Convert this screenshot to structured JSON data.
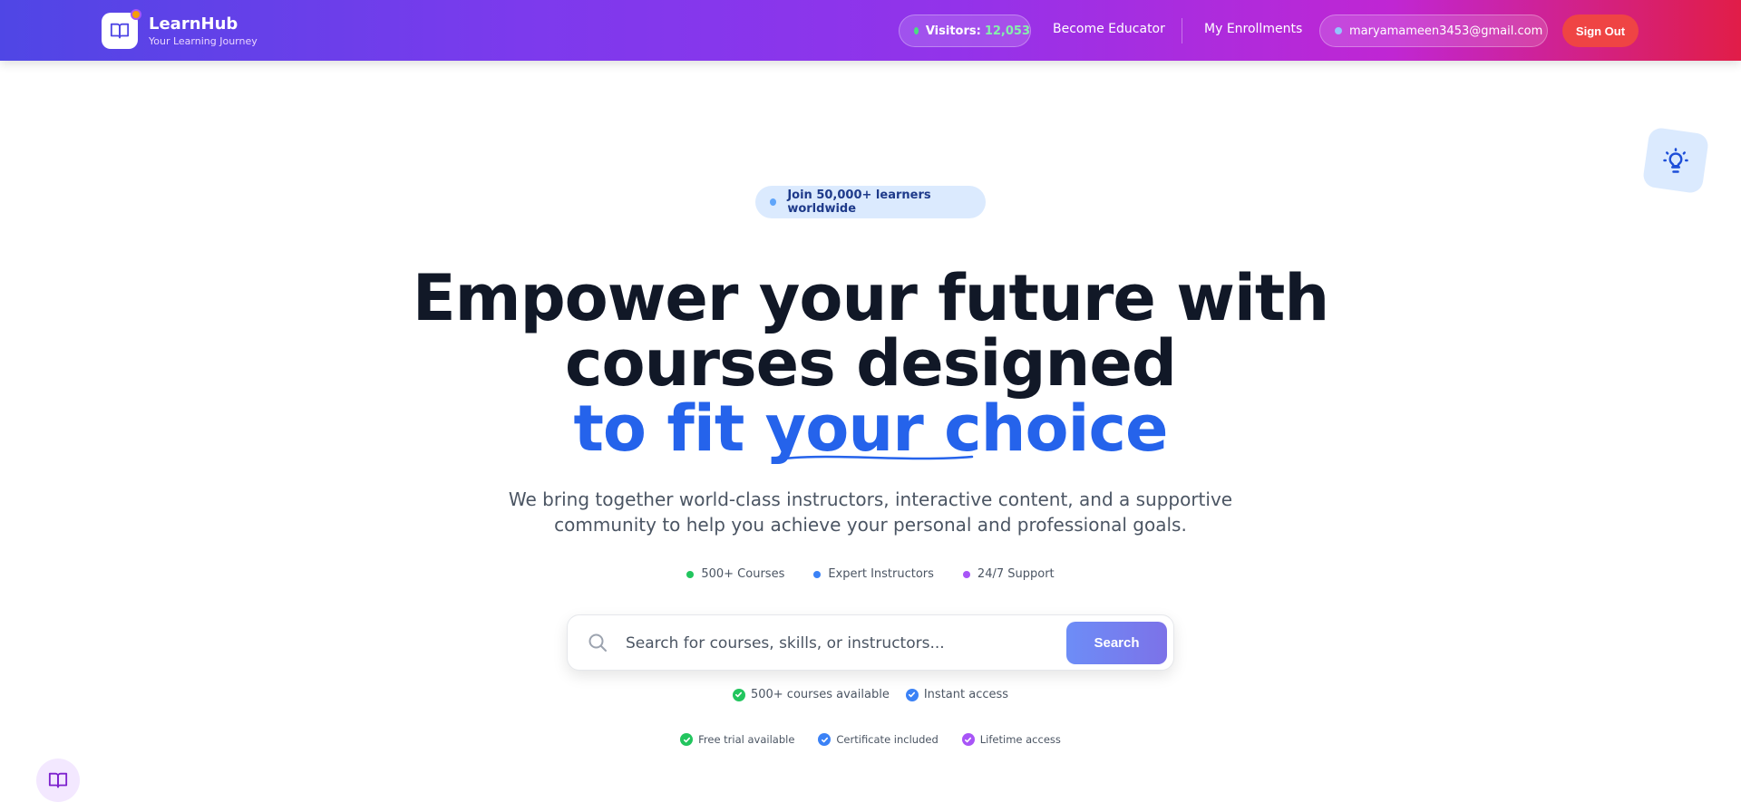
{
  "nav": {
    "brand": "LearnHub",
    "tagline": "Your Learning Journey",
    "visitors_label": "Visitors:",
    "visitors_count": "12,053",
    "become_educator": "Become Educator",
    "my_enrollments": "My Enrollments",
    "user_email": "maryamameen3453@gmail.com",
    "sign_out": "Sign Out"
  },
  "hero": {
    "badge": "Join 50,000+ learners worldwide",
    "title_line1": "Empower your future with",
    "title_line2": "courses designed",
    "title_line3": "to fit your choice",
    "subtitle_line1": "We bring together world-class instructors, interactive content, and a supportive",
    "subtitle_line2": "community to help you achieve your personal and professional goals.",
    "features": [
      {
        "label": "500+ Courses",
        "color": "#22c55e"
      },
      {
        "label": "Expert Instructors",
        "color": "#3b82f6"
      },
      {
        "label": "24/7 Support",
        "color": "#a855f7"
      }
    ]
  },
  "search": {
    "placeholder": "Search for courses, skills, or instructors...",
    "button": "Search"
  },
  "checks_primary": [
    {
      "label": "500+ courses available",
      "color": "#22c55e"
    },
    {
      "label": "Instant access",
      "color": "#3b82f6"
    }
  ],
  "checks_secondary": [
    {
      "label": "Free trial available",
      "color": "#22c55e"
    },
    {
      "label": "Certificate included",
      "color": "#3b82f6"
    },
    {
      "label": "Lifetime access",
      "color": "#a855f7"
    }
  ],
  "icons": {
    "logo": "book-open-icon",
    "bulb": "lightbulb-icon",
    "search": "search-icon",
    "floating": "book-open-icon"
  }
}
